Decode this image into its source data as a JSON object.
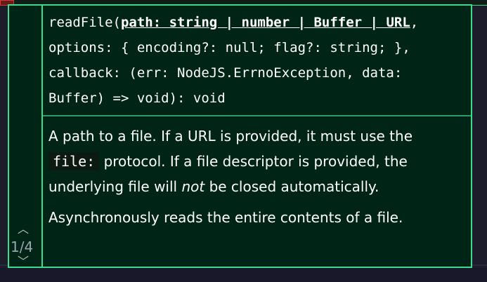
{
  "signature": {
    "prefix": "readFile(",
    "active_param": "path: string | number | Buffer | URL",
    "rest": ", options: { encoding?: null; flag?: string; }, callback: (err: NodeJS.ErrnoException, data: Buffer) => void): void"
  },
  "overload_nav": {
    "counter": "1/4",
    "up_icon": "chevron-up",
    "down_icon": "chevron-down"
  },
  "param_doc": {
    "part1": "A path to a file. If a URL is provided, it must use the ",
    "code": "file:",
    "part2": " protocol. If a file descriptor is provided, the underlying file will ",
    "emphasis": "not",
    "part3": " be closed automatically."
  },
  "function_doc": "Asynchronously reads the entire contents of a file.",
  "colors": {
    "background": "#002416",
    "border": "#3cdc8c",
    "text": "#ffffff"
  }
}
